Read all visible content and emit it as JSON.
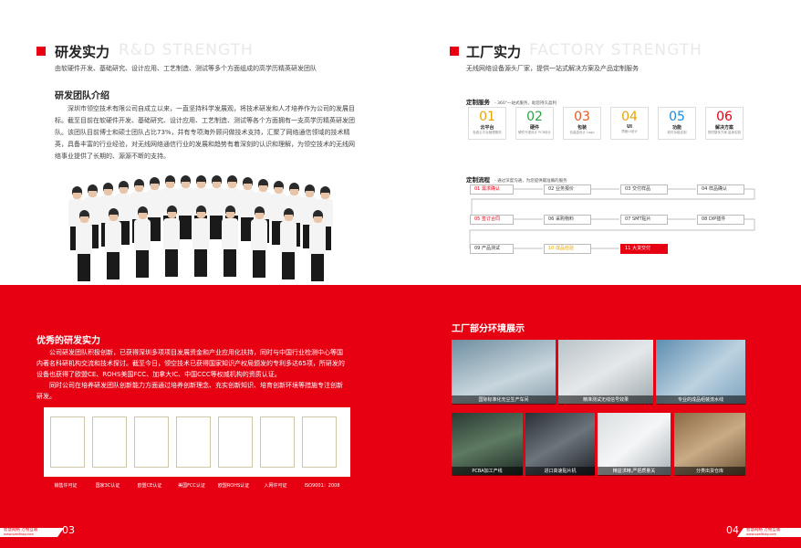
{
  "left": {
    "title": "研发实力",
    "ghost": "R&D STRENGTH",
    "subtitle": "由软硬件开发、基础研究、设计应用、工艺制造、测试等多个方面组成的高学历精英研发团队",
    "team_heading": "研发团队介绍",
    "team_text": "深圳市领空技术有限公司自成立以来，一直坚持科学发展观，将技术研发和人才培养作为公司的发展目标。截至目前在软硬件开发、基础研究、设计应用、工艺制造、测试等各个方面拥有一支高学历精英研发团队。该团队目前博士和硕士团队占比73%，并有专项海外顾问做技术支持，汇聚了网络通信领域的技术精英，具备丰富的行业经验，对无线网络通信行业的发展和趋势有着深刻的认识和理解，为领空技术的无线网络事业提供了长期的、源源不断的支持。",
    "strength_heading": "优秀的研发实力",
    "strength_text1": "公司研发团队积极创新，已获得深圳多项项目发展资金和产业应用化扶持，同时与中国行业检测中心等国内著名科研机构交流和技术探讨。截至今日，领空技术已获得国家知识产权局颁发的专利多达65项，所研发的设备也获得了欧盟CE、ROHS美国FCC、加拿大IC、中国CCC等权威机构的资质认证。",
    "strength_text2": "同时公司在培养研发团队创新能力方面通过培养创新理念、充实创新知识、培育创新环境等措施专注创新研发。",
    "certs": [
      "销售许可证",
      "国家3C认证",
      "欧盟CE认证",
      "美国FCC认证",
      "欧盟ROHS认证",
      "入网许可证",
      "ISO9001：2008"
    ],
    "footer_brand": "智慧网络 万物互联",
    "footer_url": "www.szwifisky.com",
    "page_num": "03"
  },
  "right": {
    "title": "工厂实力",
    "ghost": "FACTORY STRENGTH",
    "subtitle": "无线网络设备源头厂家，提供一站式解决方案及产品定制服务",
    "service_heading": "定制服务",
    "service_sub": "- 360°一站式服务，助您持久盈利",
    "cards": [
      {
        "num": "01",
        "label": "云平台",
        "desc": "免费云平台管理服务",
        "color": "#e8a400"
      },
      {
        "num": "02",
        "label": "硬件",
        "desc": "硬件外观设计 PCB设计",
        "color": "#2aa543"
      },
      {
        "num": "03",
        "label": "包装",
        "desc": "包装盒设计 Logo",
        "color": "#e85a1e"
      },
      {
        "num": "04",
        "label": "UI",
        "desc": "界面UI设计",
        "color": "#e8a400"
      },
      {
        "num": "05",
        "label": "功能",
        "desc": "软件功能定制",
        "color": "#1e88d8"
      },
      {
        "num": "06",
        "label": "解决方案",
        "desc": "提供整体方案 量身定制",
        "color": "#e60012"
      }
    ],
    "process_heading": "定制流程",
    "process_sub": "- 通过深度沟通，为您提供最准确的服务",
    "steps": [
      {
        "label": "01 需求确认",
        "style": "red"
      },
      {
        "label": "02 业务报价",
        "style": "normal"
      },
      {
        "label": "03 交付样品",
        "style": "normal"
      },
      {
        "label": "04 样品确认",
        "style": "normal"
      },
      {
        "label": "05 签订合同",
        "style": "red"
      },
      {
        "label": "06 采购物料",
        "style": "normal"
      },
      {
        "label": "07 SMT贴片",
        "style": "normal"
      },
      {
        "label": "08 DIP插件",
        "style": "normal"
      },
      {
        "label": "09 产品测试",
        "style": "normal"
      },
      {
        "label": "10 成品检验",
        "style": "yellow"
      },
      {
        "label": "11 大货交付",
        "style": "fill"
      }
    ],
    "env_heading": "工厂部分环境展示",
    "photos": [
      "国际标准化无尘生产车间",
      "精准测试无线信号效果",
      "专业的成品组装流水线",
      "PCBA加工产线",
      "进口高速贴片机",
      "精益求精,严把质量关",
      "分类出货仓库"
    ],
    "footer_brand": "智慧网络 万物互联",
    "footer_url": "www.szwifisky.com",
    "page_num": "04"
  }
}
